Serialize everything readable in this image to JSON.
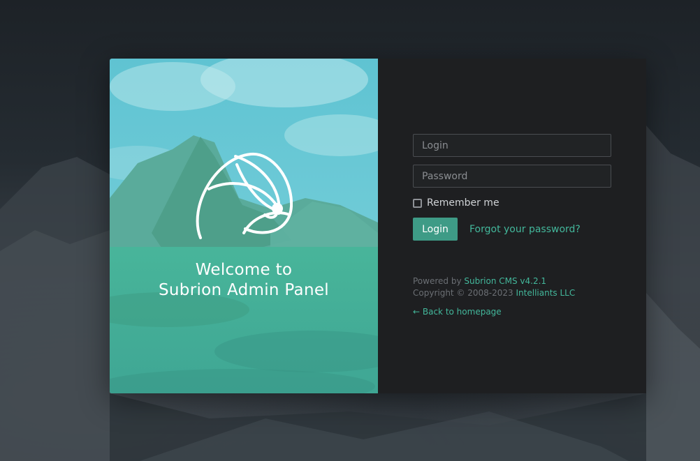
{
  "brand": {
    "welcome_line1": "Welcome to",
    "welcome_line2": "Subrion Admin Panel"
  },
  "form": {
    "login_placeholder": "Login",
    "password_placeholder": "Password",
    "remember_label": "Remember me",
    "remember_checked": false,
    "login_button": "Login",
    "forgot_link": "Forgot your password?"
  },
  "footer": {
    "powered_by_prefix": "Powered by",
    "cms_link": "Subrion CMS v4.2.1",
    "copyright_prefix": "Copyright © 2008-2023",
    "company_link": "Intelliants LLC",
    "back_link": "← Back to homepage"
  },
  "colors": {
    "accent": "#3e9b86",
    "link": "#43b79b",
    "panel_dark": "#1e1f21",
    "overlay_teal": "#4fb7c4"
  },
  "icons": {
    "logo": "subrion-logo-icon"
  }
}
